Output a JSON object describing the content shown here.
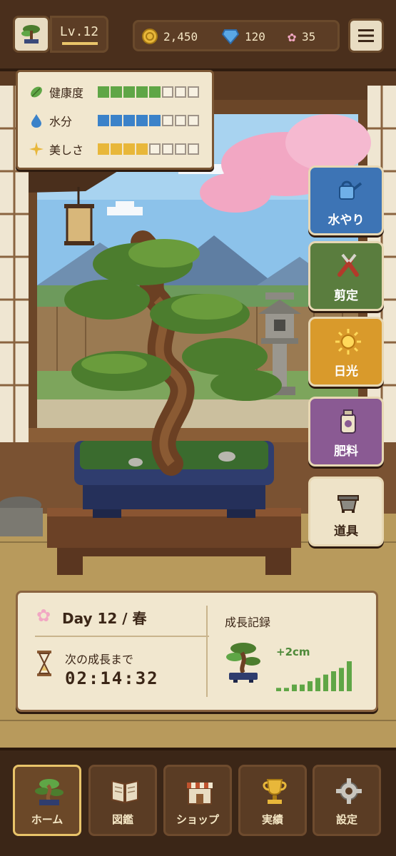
{
  "player": {
    "level": "Lv.12"
  },
  "currency": {
    "coins": "2,450",
    "gems": "120",
    "blossoms": "35"
  },
  "stats": [
    {
      "label": "健康度",
      "icon": "leaf-icon",
      "filled": 5,
      "total": 8,
      "color": "#5fa646"
    },
    {
      "label": "水分",
      "icon": "water-drop-icon",
      "filled": 5,
      "total": 8,
      "color": "#3b82c9"
    },
    {
      "label": "美しさ",
      "icon": "sparkle-icon",
      "filled": 4,
      "total": 8,
      "color": "#e8b73a"
    }
  ],
  "actions": [
    {
      "label": "水やり",
      "icon": "watering-can-icon",
      "color": "#3d74b5"
    },
    {
      "label": "剪定",
      "icon": "pruning-shears-icon",
      "color": "#5a7d3e"
    },
    {
      "label": "日光",
      "icon": "sun-icon",
      "color": "#d99a2b"
    },
    {
      "label": "肥料",
      "icon": "fertilizer-icon",
      "color": "#8a5a93"
    },
    {
      "label": "道具",
      "icon": "pot-tool-icon",
      "color": "#eee3c8"
    }
  ],
  "info": {
    "day": "Day 12 / 春",
    "next_label": "次の成長まで",
    "timer": "02:14:32",
    "growth_title": "成長記録",
    "growth_delta": "+2cm",
    "growth_bars": [
      1,
      1,
      2,
      2,
      3,
      4,
      5,
      6,
      7,
      9
    ]
  },
  "nav": [
    {
      "label": "ホーム",
      "icon": "bonsai-home-icon",
      "active": true
    },
    {
      "label": "図鑑",
      "icon": "book-icon",
      "active": false
    },
    {
      "label": "ショップ",
      "icon": "shop-icon",
      "active": false
    },
    {
      "label": "実績",
      "icon": "trophy-icon",
      "active": false
    },
    {
      "label": "設定",
      "icon": "gear-icon",
      "active": false
    }
  ],
  "colors": {
    "wood_dark": "#3b2617",
    "panel_cream": "#f1e7cf",
    "accent_gold": "#e9c46a",
    "sky": "#8cc2ea",
    "sakura": "#f2a7c3"
  }
}
